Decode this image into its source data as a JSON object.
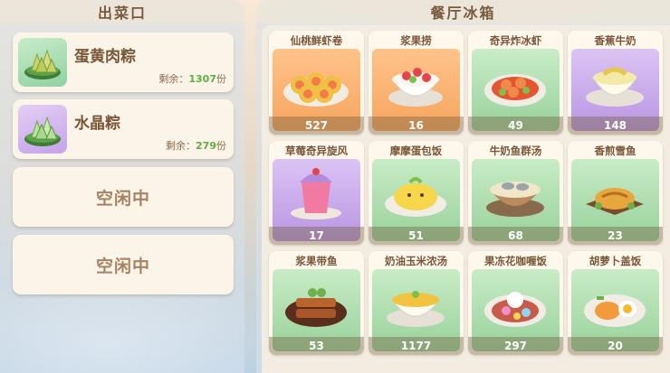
{
  "left": {
    "title": "出菜口",
    "remain_label": "剩余：",
    "unit": "份",
    "slots": [
      {
        "name": "蛋黄肉粽",
        "remain": "1307",
        "icon": "zongzi-icon"
      },
      {
        "name": "水晶粽",
        "remain": "279",
        "icon": "zongzi-icon"
      }
    ],
    "idle_slots": [
      "空闲中",
      "空闲中"
    ]
  },
  "right": {
    "title": "餐厅冰箱",
    "dishes": [
      {
        "name": "仙桃鲜虾卷",
        "count": "527",
        "bg": "orange",
        "icon": "shrimp-roll-dish-icon"
      },
      {
        "name": "浆果捞",
        "count": "16",
        "bg": "orange",
        "icon": "berry-bowl-dish-icon"
      },
      {
        "name": "奇异炸冰虾",
        "count": "49",
        "bg": "green",
        "icon": "fried-shrimp-dish-icon"
      },
      {
        "name": "香蕉牛奶",
        "count": "148",
        "bg": "purple",
        "icon": "banana-milk-dish-icon"
      },
      {
        "name": "草莓奇异旋风",
        "count": "17",
        "bg": "purple",
        "icon": "strawberry-drink-icon"
      },
      {
        "name": "摩摩蛋包饭",
        "count": "51",
        "bg": "green",
        "icon": "omelette-rice-icon"
      },
      {
        "name": "牛奶鱼群汤",
        "count": "68",
        "bg": "green",
        "icon": "fish-soup-icon"
      },
      {
        "name": "香煎雪鱼",
        "count": "23",
        "bg": "green",
        "icon": "fried-cod-icon"
      },
      {
        "name": "浆果带鱼",
        "count": "53",
        "bg": "green",
        "icon": "berry-hairtail-icon"
      },
      {
        "name": "奶油玉米浓汤",
        "count": "1177",
        "bg": "green",
        "icon": "corn-soup-icon"
      },
      {
        "name": "果冻花咖喱饭",
        "count": "297",
        "bg": "green",
        "icon": "jelly-curry-icon"
      },
      {
        "name": "胡萝卜盖饭",
        "count": "20",
        "bg": "green",
        "icon": "carrot-rice-icon"
      }
    ]
  }
}
